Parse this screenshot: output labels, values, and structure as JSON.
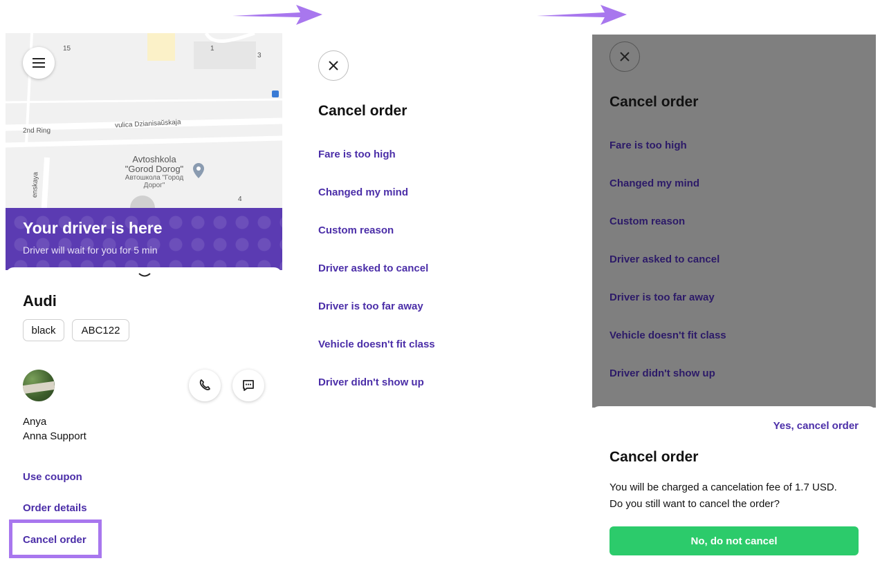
{
  "colors": {
    "accent": "#4b2ea8",
    "banner": "#5b3bb2",
    "arrow": "#a877ee",
    "confirm_button": "#2ccb6b",
    "overlay": "#7f7f7f"
  },
  "screen1": {
    "map": {
      "labels": [
        "15",
        "1",
        "3",
        "2nd Ring",
        "vulica Dzianisaŭskaja",
        "4",
        "enskaya"
      ],
      "poi": {
        "name": "Avtoshkola \"Gorod Dorog\"",
        "sub": "Автошкола \"Город Дорог\""
      }
    },
    "banner": {
      "title": "Your driver is here",
      "subtitle": "Driver will wait for you for 5 min"
    },
    "car": {
      "model": "Audi",
      "color": "black",
      "plate": "ABC122"
    },
    "driver": {
      "name": "Anya",
      "company": "Anna Support"
    },
    "links": {
      "coupon": "Use coupon",
      "details": "Order details",
      "cancel": "Cancel order"
    }
  },
  "screen2": {
    "title": "Cancel order",
    "reasons": [
      "Fare is too high",
      "Changed my mind",
      "Custom reason",
      "Driver asked to cancel",
      "Driver is too far away",
      "Vehicle doesn't fit class",
      "Driver didn't show up"
    ]
  },
  "screen3": {
    "title": "Cancel order",
    "reasons": [
      "Fare is too high",
      "Changed my mind",
      "Custom reason",
      "Driver asked to cancel",
      "Driver is too far away",
      "Vehicle doesn't fit class",
      "Driver didn't show up"
    ],
    "dialog": {
      "confirm": "Yes, cancel order",
      "title": "Cancel order",
      "message": "You will be charged a cancelation fee of 1.7 USD. Do you still want to cancel the order?",
      "dismiss": "No, do not cancel"
    }
  }
}
